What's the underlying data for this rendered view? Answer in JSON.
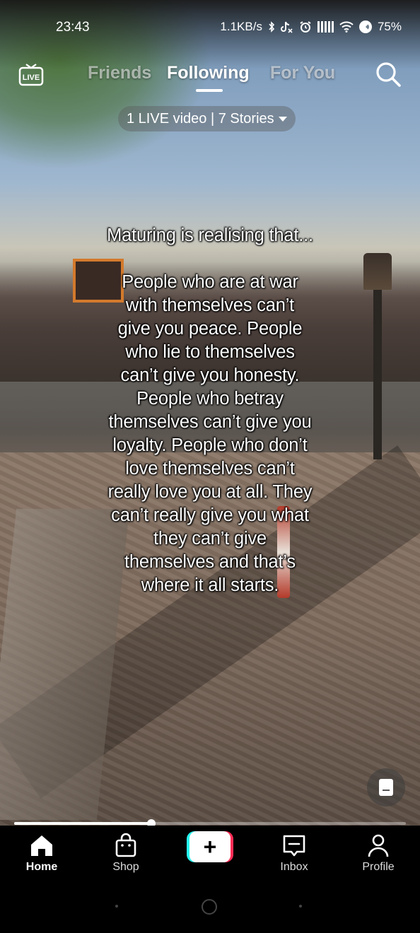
{
  "status_bar": {
    "time": "23:43",
    "net_speed": "1.1KB/s",
    "battery": "75%"
  },
  "top_nav": {
    "live_label": "LIVE",
    "tabs": [
      {
        "label": "Friends",
        "active": false
      },
      {
        "label": "Following",
        "active": true
      },
      {
        "label": "For You",
        "active": false
      }
    ]
  },
  "stories_pill": {
    "label": "1 LIVE video | 7 Stories"
  },
  "video": {
    "caption_title": "Maturing is realising that...",
    "caption_lines": [
      "People who are at war",
      "with themselves can’t",
      "give you peace. People",
      "who lie to themselves",
      "can’t give you honesty.",
      "People who betray",
      "themselves can’t give you",
      "loyalty. People who don’t",
      "love themselves can’t",
      "really love you at all. They",
      "can’t really give you what",
      "they can’t give",
      "themselves and that’s",
      "where it all starts."
    ],
    "progress": 0.35
  },
  "bottom_nav": {
    "items": [
      {
        "label": "Home",
        "icon": "home-icon",
        "active": true
      },
      {
        "label": "Shop",
        "icon": "shopping-bag-icon",
        "active": false
      },
      {
        "label": "Inbox",
        "icon": "inbox-icon",
        "active": false
      },
      {
        "label": "Profile",
        "icon": "profile-icon",
        "active": false
      }
    ],
    "create_symbol": "+"
  }
}
